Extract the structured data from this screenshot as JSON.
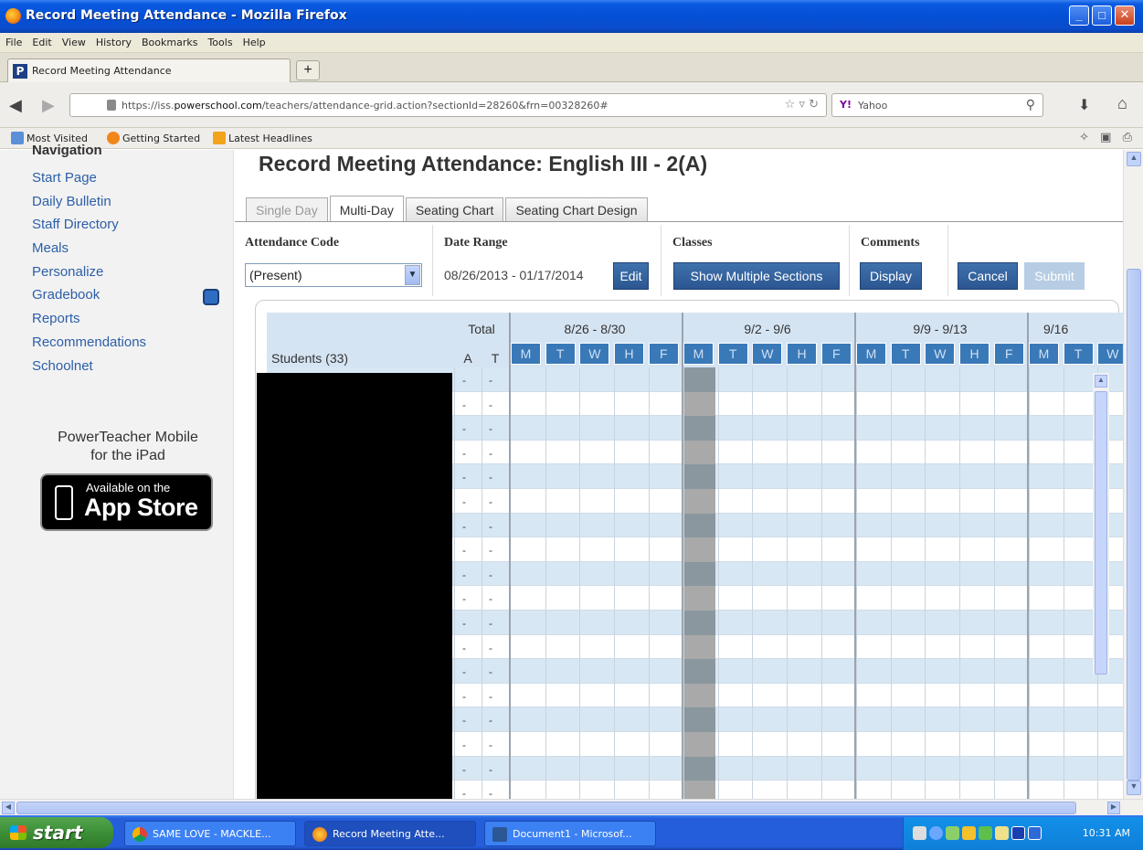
{
  "window": {
    "title": "Record Meeting Attendance - Mozilla Firefox"
  },
  "menubar": [
    "File",
    "Edit",
    "View",
    "History",
    "Bookmarks",
    "Tools",
    "Help"
  ],
  "browser_tab": {
    "label": "Record Meeting Attendance",
    "favicon": "P"
  },
  "url": {
    "prefix": "https://iss.",
    "domain": "powerschool.com",
    "path": "/teachers/attendance-grid.action?sectionId=28260&frn=00328260#"
  },
  "search": {
    "engine": "Yahoo"
  },
  "bookmarks": [
    "Most Visited",
    "Getting Started",
    "Latest Headlines"
  ],
  "sidebar": {
    "heading": "Navigation",
    "items": [
      "Start Page",
      "Daily Bulletin",
      "Staff Directory",
      "Meals",
      "Personalize",
      "Gradebook",
      "Reports",
      "Recommendations",
      "Schoolnet"
    ],
    "promo_line1": "PowerTeacher Mobile",
    "promo_line2": "for the iPad",
    "appstore_line1": "Available on the",
    "appstore_line2": "App Store"
  },
  "page": {
    "title": "Record Meeting Attendance: English III - 2(A)",
    "tabs": [
      "Single Day",
      "Multi-Day",
      "Seating Chart",
      "Seating Chart Design"
    ],
    "attendance_code_label": "Attendance Code",
    "attendance_code_value": "(Present)",
    "date_range_label": "Date Range",
    "date_range_value": "08/26/2013 - 01/17/2014",
    "edit_button": "Edit",
    "classes_label": "Classes",
    "show_multiple_button": "Show Multiple Sections",
    "comments_label": "Comments",
    "display_button": "Display",
    "cancel_button": "Cancel",
    "submit_button": "Submit"
  },
  "grid": {
    "students_header": "Students (33)",
    "total_header": "Total",
    "total_cols": [
      "A",
      "T"
    ],
    "weeks": [
      "8/26 - 8/30",
      "9/2 - 9/6",
      "9/9 - 9/13",
      "9/16"
    ],
    "days": [
      "M",
      "T",
      "W",
      "H",
      "F"
    ],
    "row_value": "-"
  },
  "taskbar": {
    "start": "start",
    "tasks": [
      "SAME LOVE - MACKLE...",
      "Record Meeting Atte...",
      "Document1 - Microsof..."
    ],
    "clock": "10:31 AM"
  }
}
